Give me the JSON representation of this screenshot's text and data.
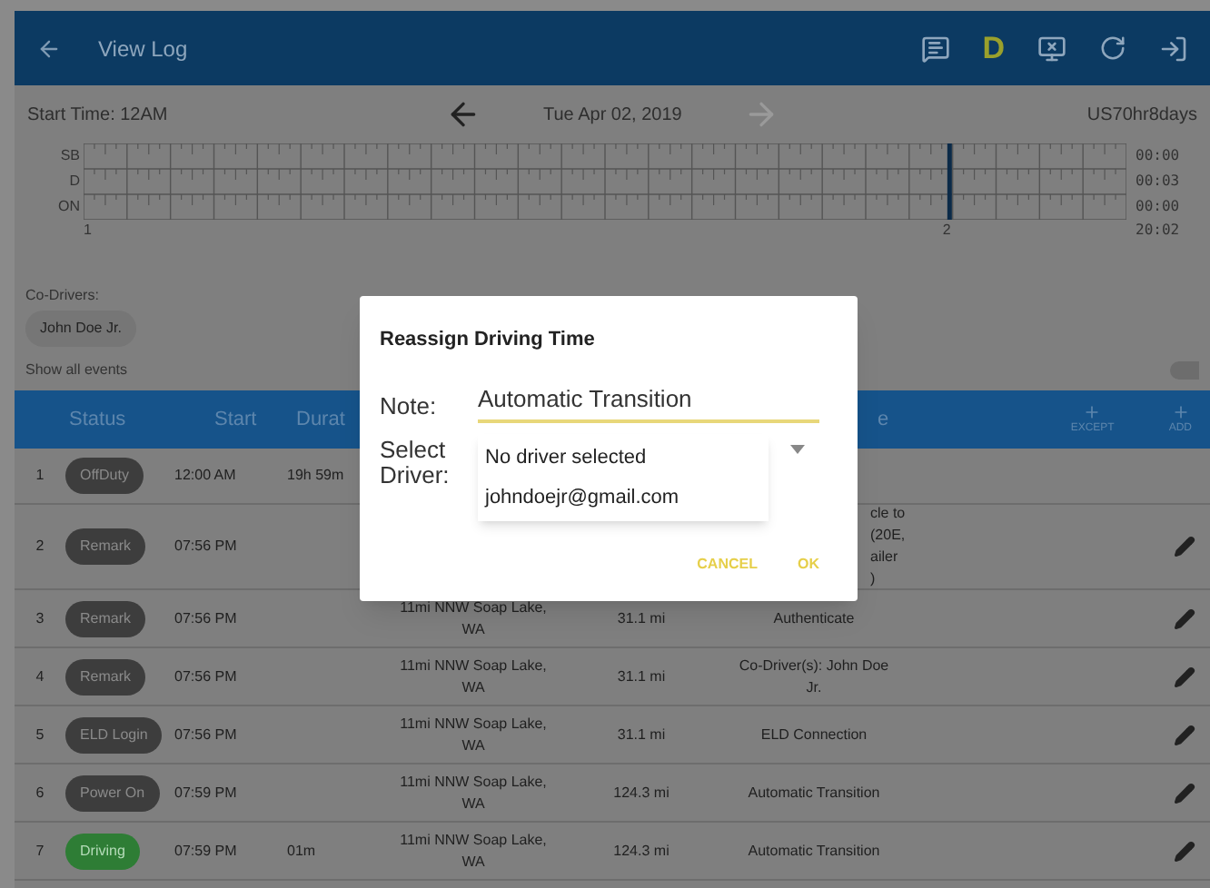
{
  "toolbar": {
    "title": "View Log",
    "driver_letter": "D"
  },
  "date_nav": {
    "start_time": "Start Time: 12AM",
    "date": "Tue Apr 02, 2019",
    "next_disabled": true,
    "ruleset": "US70hr8days"
  },
  "timeline": {
    "rows": [
      {
        "label": "SB",
        "total": "00:00"
      },
      {
        "label": "D",
        "total": "00:03"
      },
      {
        "label": "ON",
        "total": "00:00"
      }
    ],
    "start_label": "1",
    "marker_label": "2",
    "grand_total": "20:02"
  },
  "co_drivers": {
    "label": "Co-Drivers:",
    "names": [
      "John Doe Jr."
    ]
  },
  "show_all_events": {
    "label": "Show all events",
    "on": false
  },
  "table": {
    "columns": [
      "Status",
      "Start",
      "Durat",
      "e"
    ],
    "actions": [
      "EXCEPT",
      "ADD"
    ],
    "rows": [
      {
        "number": "1",
        "status": "OffDuty",
        "color": "#3d3d3d",
        "start": "12:00 AM",
        "duration": "19h 59m",
        "editable": false
      },
      {
        "number": "2",
        "status": "Remark",
        "color": "#3d3d3d",
        "start": "07:56 PM",
        "note": "cle to\n(20E,\nailer\n)",
        "editable": true
      },
      {
        "number": "3",
        "status": "Remark",
        "color": "#3d3d3d",
        "start": "07:56 PM",
        "location": "11mi NNW Soap Lake,\nWA",
        "distance": "31.1 mi",
        "note": "Authenticate",
        "editable": true
      },
      {
        "number": "4",
        "status": "Remark",
        "color": "#3d3d3d",
        "start": "07:56 PM",
        "location": "11mi NNW Soap Lake,\nWA",
        "distance": "31.1 mi",
        "note": "Co-Driver(s): John Doe\nJr.",
        "editable": true
      },
      {
        "number": "5",
        "status": "ELD Login",
        "color": "#3d3d3d",
        "start": "07:56 PM",
        "location": "11mi NNW Soap Lake,\nWA",
        "distance": "31.1 mi",
        "note": "ELD Connection",
        "editable": true
      },
      {
        "number": "6",
        "status": "Power On",
        "color": "#3d3d3d",
        "start": "07:59 PM",
        "location": "11mi NNW Soap Lake,\nWA",
        "distance": "124.3 mi",
        "note": "Automatic Transition",
        "editable": true
      },
      {
        "number": "7",
        "status": "Driving",
        "color": "#2e7d35",
        "start": "07:59 PM",
        "duration": "01m",
        "location": "11mi NNW Soap Lake,\nWA",
        "distance": "124.3 mi",
        "note": "Automatic Transition",
        "editable": true
      }
    ]
  },
  "dialog": {
    "title": "Reassign Driving Time",
    "note_label": "Note:",
    "note_value": "Automatic Transition",
    "driver_label": "Select\nDriver:",
    "options": [
      "No driver selected",
      "johndoejr@gmail.com"
    ],
    "buttons": [
      "CANCEL",
      "OK"
    ]
  }
}
